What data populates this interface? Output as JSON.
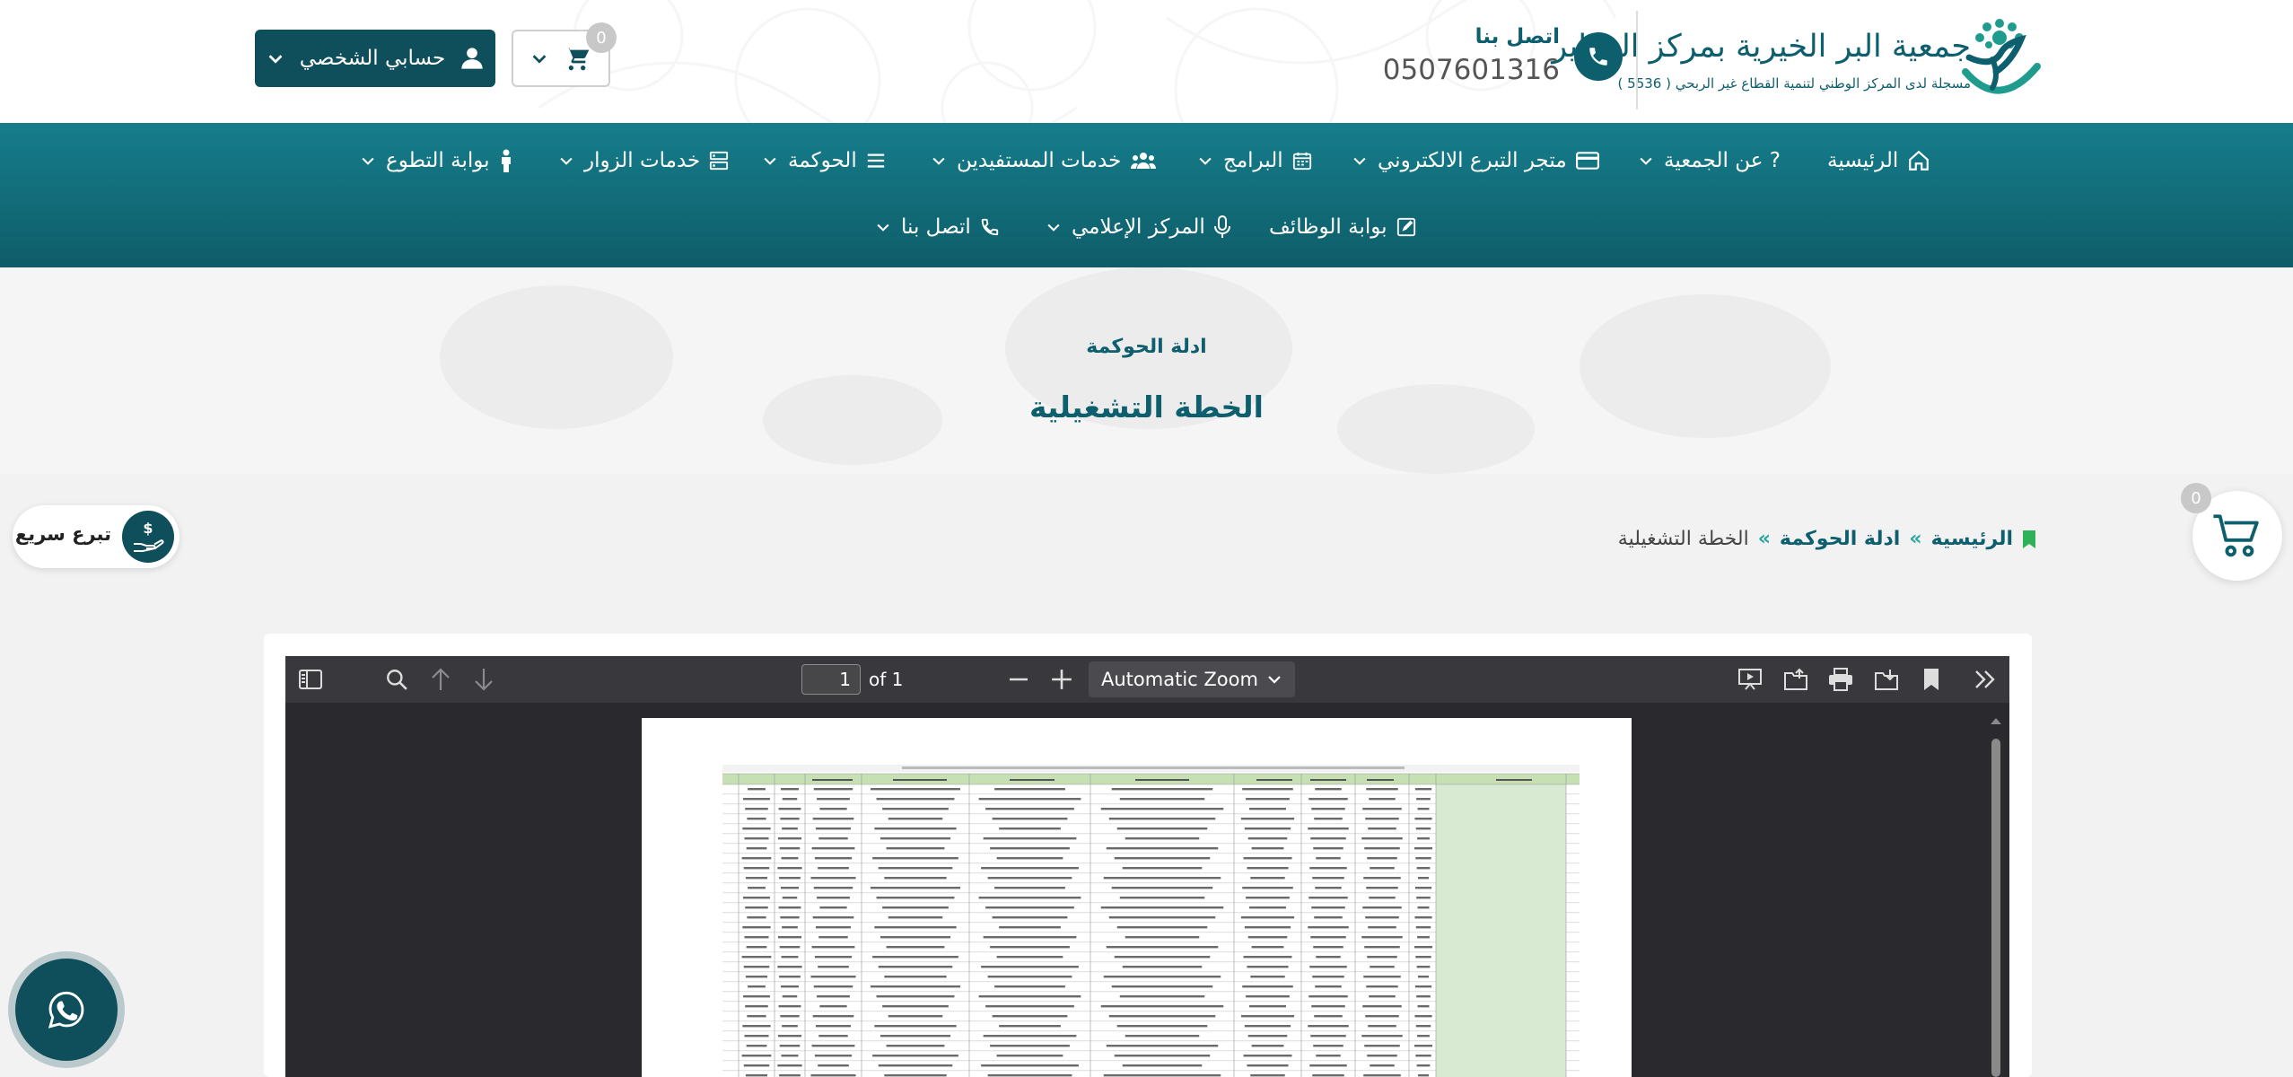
{
  "header": {
    "org_name": "جمعية البر الخيرية بمركز العماير",
    "org_subtitle": "مسجلة لدى المركز الوطني لتنمية القطاع غير الربحي ( 5536 )",
    "contact_label": "اتصل بنا",
    "contact_phone": "0507601316",
    "cart_count": "0",
    "account_label": "حسابي الشخصي"
  },
  "nav": {
    "items": [
      {
        "label": "الرئيسية",
        "icon": "home-icon"
      },
      {
        "label": "? عن الجمعية",
        "icon": ""
      },
      {
        "label": "متجر التبرع الالكتروني",
        "icon": "card-icon"
      },
      {
        "label": "البرامج",
        "icon": "calendar-icon"
      },
      {
        "label": "خدمات المستفيدين",
        "icon": "users-icon"
      },
      {
        "label": "الحوكمة",
        "icon": "list-icon"
      },
      {
        "label": "خدمات الزوار",
        "icon": "server-icon"
      },
      {
        "label": "بوابة التطوع",
        "icon": "person-icon"
      },
      {
        "label": "بوابة الوظائف",
        "icon": "edit-icon"
      },
      {
        "label": "المركز الإعلامي",
        "icon": "mic-icon"
      },
      {
        "label": "اتصل بنا",
        "icon": "phone-icon"
      }
    ]
  },
  "hero": {
    "kicker": "ادلة الحوكمة",
    "title": "الخطة التشغيلية"
  },
  "breadcrumb": {
    "home": "الرئيسية",
    "sep": "»",
    "parent": "ادلة الحوكمة",
    "current": "الخطة التشغيلية"
  },
  "widgets": {
    "quick_donate": "تبرع سريع",
    "float_cart_count": "0"
  },
  "pdf_viewer": {
    "page_value": "1",
    "page_of": "of 1",
    "zoom": "Automatic Zoom"
  },
  "colors": {
    "brand": "#0d5f6e",
    "nav_top": "#167d8b",
    "nav_bottom": "#0e5d69",
    "accent": "#2aa3a3",
    "toolbar": "#38383d"
  }
}
